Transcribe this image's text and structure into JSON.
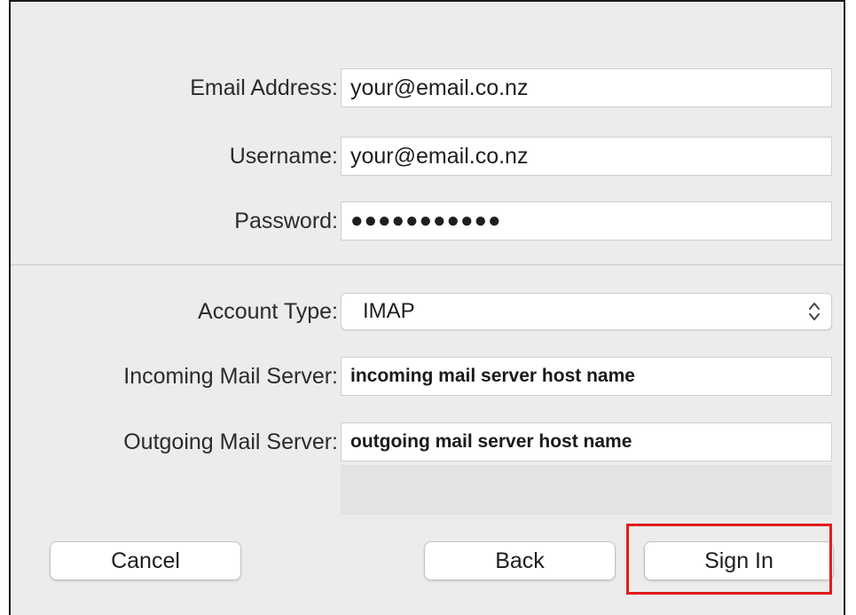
{
  "form": {
    "email": {
      "label": "Email Address:",
      "value": "your@email.co.nz"
    },
    "username": {
      "label": "Username:",
      "value": "your@email.co.nz"
    },
    "password": {
      "label": "Password:",
      "value": "●●●●●●●●●●●"
    },
    "account_type": {
      "label": "Account Type:",
      "value": "IMAP"
    },
    "incoming_server": {
      "label": "Incoming Mail Server:",
      "value": "incoming mail server host name"
    },
    "outgoing_server": {
      "label": "Outgoing Mail Server:",
      "value": "outgoing mail server host name"
    }
  },
  "buttons": {
    "cancel": "Cancel",
    "back": "Back",
    "sign_in": "Sign In"
  },
  "colors": {
    "dialog_background": "#ececec",
    "highlight": "#e01b1b"
  },
  "icons": {
    "select_arrows": "up-down-chevron-icon"
  }
}
